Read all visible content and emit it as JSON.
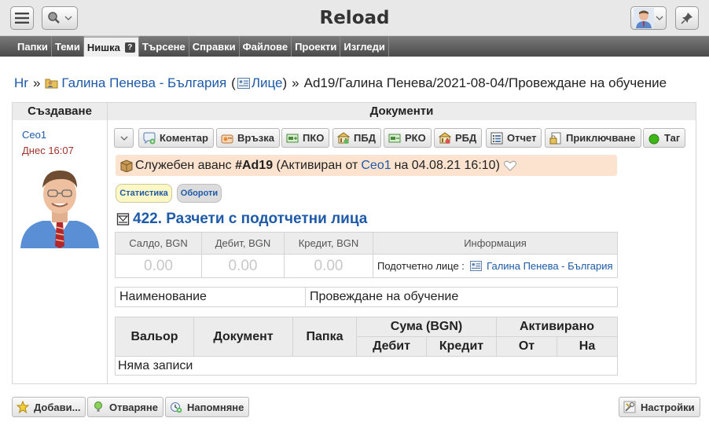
{
  "header": {
    "title": "Reload"
  },
  "tabs": [
    {
      "label": "Папки"
    },
    {
      "label": "Теми"
    },
    {
      "label": "Нишка"
    },
    {
      "label": "Търсене"
    },
    {
      "label": "Справки"
    },
    {
      "label": "Файлове"
    },
    {
      "label": "Проекти"
    },
    {
      "label": "Изгледи"
    }
  ],
  "breadcrumb": {
    "root": "Hr",
    "sep": "»",
    "contact": "Галина Пенева - България",
    "paren_open": "(",
    "folder": "Лице",
    "paren_close": ")",
    "sep2": "»",
    "thread": "Ad19/Галина Пенева/2021-08-04/Провеждане на обучение"
  },
  "columns": {
    "left": "Създаване",
    "right": "Документи"
  },
  "creator": {
    "name": "Ceo1",
    "date": "Днес 16:07"
  },
  "actions": [
    {
      "label": "Коментар"
    },
    {
      "label": "Връзка"
    },
    {
      "label": "ПКО"
    },
    {
      "label": "ПБД"
    },
    {
      "label": "РКО"
    },
    {
      "label": "РБД"
    },
    {
      "label": "Отчет"
    },
    {
      "label": "Приключване"
    },
    {
      "label": "Таг"
    }
  ],
  "advance": {
    "prefix": "Служебен аванс ",
    "code": "#Ad19",
    "activated": " (Активиран от",
    "user": "Ceo1",
    "date": "на 04.08.21 16:10)"
  },
  "chips": {
    "stats": "Статистика",
    "turnover": "Обороти"
  },
  "account": {
    "title": "422. Разчети с подотчетни лица"
  },
  "balance": {
    "headers": [
      "Салдо, BGN",
      "Дебит, BGN",
      "Кредит, BGN",
      "Информация"
    ],
    "values": [
      "0.00",
      "0.00",
      "0.00"
    ],
    "info_label": "Подотчетно лице :",
    "info_link": "Галина Пенева - България"
  },
  "name_row": {
    "key": "Наименование",
    "value": "Провеждане на обучение"
  },
  "entries": {
    "headers": {
      "valor": "Вальор",
      "document": "Документ",
      "folder": "Папка",
      "amount": "Сума (BGN)",
      "activated": "Активирано",
      "debit": "Дебит",
      "credit": "Кредит",
      "from": "От",
      "to": "На"
    },
    "empty": "Няма записи"
  },
  "bottom": {
    "add": "Добави...",
    "open": "Отваряне",
    "remind": "Напомняне",
    "settings": "Настройки"
  },
  "colors": {
    "link": "#1e5aa8",
    "advance_bg": "#fbe3cf",
    "menubar": "#5a5a5a",
    "date_red": "#a0332b"
  }
}
